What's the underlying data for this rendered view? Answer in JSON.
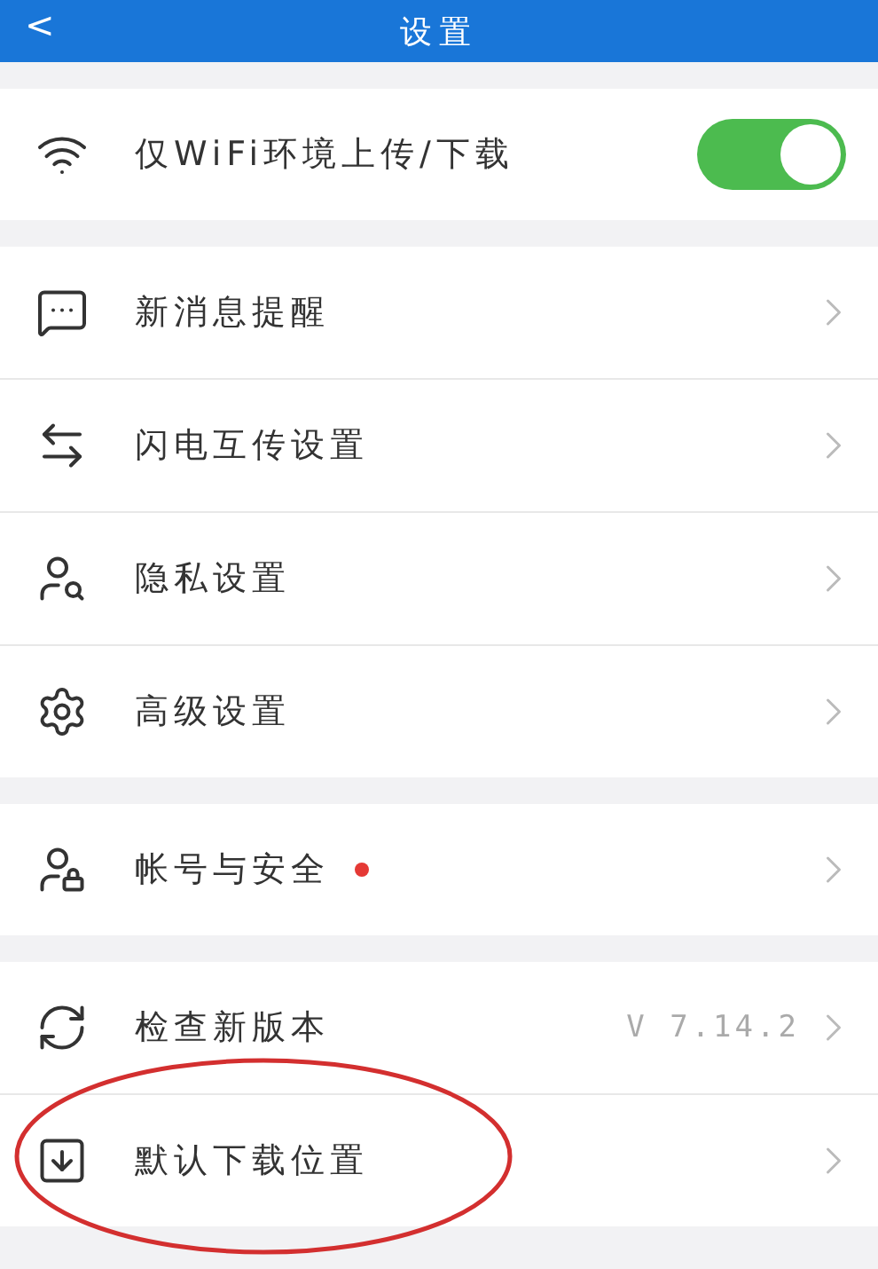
{
  "header": {
    "back": "<",
    "title": "设置"
  },
  "groups": [
    {
      "items": [
        {
          "kind": "toggle",
          "label": "仅WiFi环境上传/下载",
          "on": true
        }
      ]
    },
    {
      "items": [
        {
          "kind": "link",
          "label": "新消息提醒"
        },
        {
          "kind": "link",
          "label": "闪电互传设置"
        },
        {
          "kind": "link",
          "label": "隐私设置"
        },
        {
          "kind": "link",
          "label": "高级设置"
        }
      ]
    },
    {
      "items": [
        {
          "kind": "link",
          "label": "帐号与安全",
          "color": "#e53935"
        }
      ]
    },
    {
      "items": [
        {
          "kind": "link",
          "label": "检查新版本",
          "value": "V 7.14.2"
        },
        {
          "kind": "link",
          "label": "默认下载位置",
          "circled": true
        }
      ]
    }
  ]
}
